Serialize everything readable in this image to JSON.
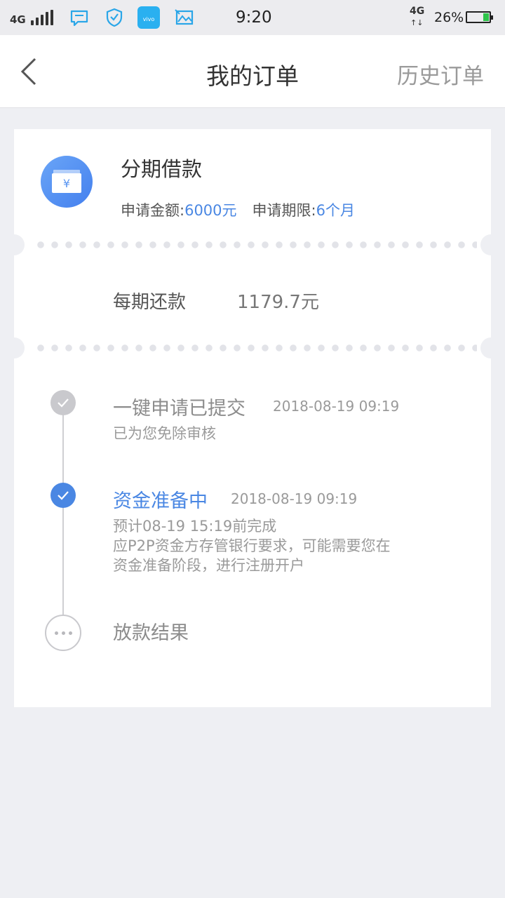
{
  "status_bar": {
    "network": "4G",
    "network2": "4G",
    "time": "9:20",
    "battery_percent": "26%",
    "battery_level": 0.26,
    "icons": [
      "signal-icon",
      "message-icon",
      "shield-icon",
      "vivo-store-icon",
      "image-icon"
    ],
    "vivo_label": "vivo"
  },
  "nav": {
    "title": "我的订单",
    "history": "历史订单"
  },
  "loan": {
    "title": "分期借款",
    "currency_symbol": "¥",
    "amount_label": "申请金额:",
    "amount_value": "6000元",
    "term_label": "申请期限:",
    "term_value": "6个月"
  },
  "repayment": {
    "label": "每期还款",
    "value": "1179.7元"
  },
  "timeline": [
    {
      "title": "一键申请已提交",
      "time": "2018-08-19 09:19",
      "lines": [
        "已为您免除审核"
      ],
      "state": "done"
    },
    {
      "title": "资金准备中",
      "time": "2018-08-19 09:19",
      "lines": [
        "预计08-19 15:19前完成",
        "应P2P资金方存管银行要求，可能需要您在",
        "资金准备阶段，进行注册开户"
      ],
      "state": "active"
    },
    {
      "title": "放款结果",
      "state": "pending"
    }
  ],
  "colors": {
    "accent": "#4a87e3",
    "muted": "#9a9a9a",
    "background": "#eeeff3"
  }
}
